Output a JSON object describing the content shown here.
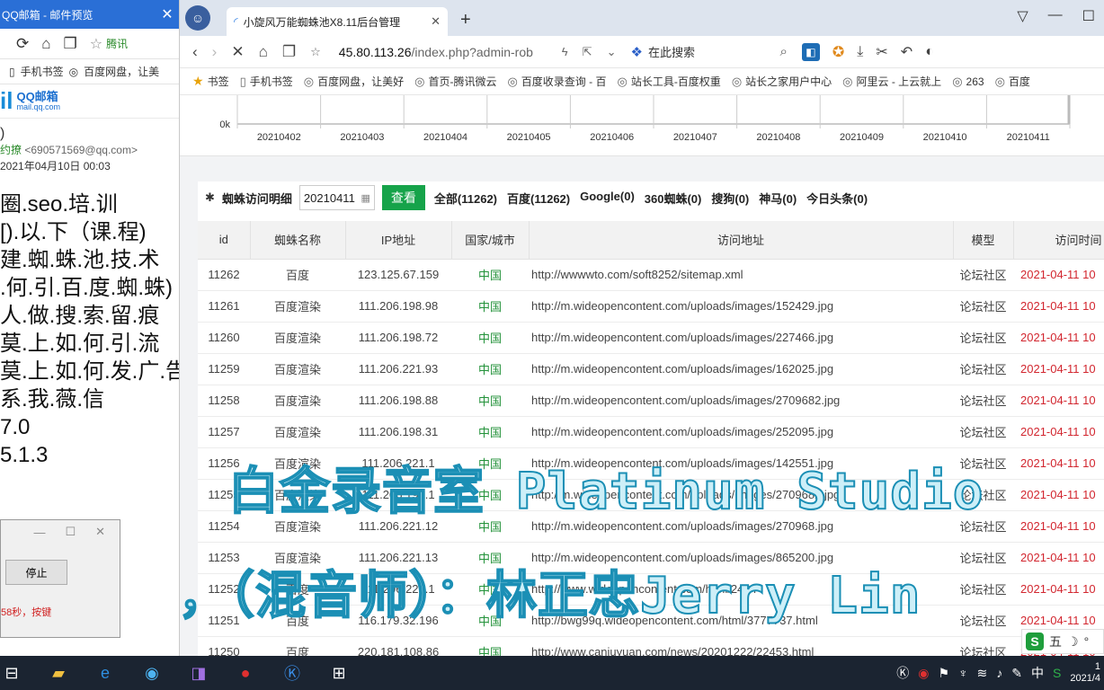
{
  "left_window": {
    "title": "QQ邮箱 - 邮件预览",
    "nav_extra": "腾讯",
    "bookmarks": [
      "手机书签",
      "百度网盘，让美"
    ],
    "logo_title": "QQ邮箱",
    "logo_sub": "mail.qq.com",
    "subject_frag": ")",
    "from_name": "约撩",
    "from_email": "<690571569@qq.com>",
    "date": "2021年04月10日 00:03",
    "body_lines": [
      "圈.seo.培.训",
      "[).以.下（课.程)",
      "建.蜘.蛛.池.技.术",
      ".何.引.百.度.蜘.蛛)",
      "人.做.搜.索.留.痕",
      "莫.上.如.何.引.流",
      "莫.上.如.何.发.广.告",
      "系.我.薇.信",
      "7.0",
      "5.1.3"
    ],
    "dialog": {
      "button": "停止",
      "status": "58秒，按键"
    }
  },
  "browser": {
    "tab_title": "小旋风万能蜘蛛池X8.11后台管理",
    "url_host": "45.80.113.26",
    "url_path": "/index.php?admin-rob",
    "search_placeholder": "在此搜索",
    "bookmarks_label": "书签",
    "bookmarks": [
      "手机书签",
      "百度网盘，让美好",
      "首页-腾讯微云",
      "百度收录查询 - 百",
      "站长工具-百度权重",
      "站长之家用户中心",
      "阿里云 - 上云就上",
      "263",
      "百度"
    ]
  },
  "chart_data": {
    "type": "line",
    "y_tick": "0k",
    "categories": [
      "20210402",
      "20210403",
      "20210404",
      "20210405",
      "20210406",
      "20210407",
      "20210408",
      "20210409",
      "20210410",
      "20210411"
    ]
  },
  "panel": {
    "title": "蜘蛛访问明细",
    "date_value": "20210411",
    "view_button": "查看",
    "filters": [
      "全部(11262)",
      "百度(11262)",
      "Google(0)",
      "360蜘蛛(0)",
      "搜狗(0)",
      "神马(0)",
      "今日头条(0)"
    ],
    "columns": [
      "id",
      "蜘蛛名称",
      "IP地址",
      "国家/城市",
      "访问地址",
      "模型",
      "访问时间"
    ],
    "rows": [
      {
        "id": "11262",
        "name": "百度",
        "ip": "123.125.67.159",
        "country": "中国",
        "url": "http://wwwwto.com/soft8252/sitemap.xml",
        "model": "论坛社区",
        "time": "2021-04-11 10"
      },
      {
        "id": "11261",
        "name": "百度渲染",
        "ip": "111.206.198.98",
        "country": "中国",
        "url": "http://m.wideopencontent.com/uploads/images/152429.jpg",
        "model": "论坛社区",
        "time": "2021-04-11 10"
      },
      {
        "id": "11260",
        "name": "百度渲染",
        "ip": "111.206.198.72",
        "country": "中国",
        "url": "http://m.wideopencontent.com/uploads/images/227466.jpg",
        "model": "论坛社区",
        "time": "2021-04-11 10"
      },
      {
        "id": "11259",
        "name": "百度渲染",
        "ip": "111.206.221.93",
        "country": "中国",
        "url": "http://m.wideopencontent.com/uploads/images/162025.jpg",
        "model": "论坛社区",
        "time": "2021-04-11 10"
      },
      {
        "id": "11258",
        "name": "百度渲染",
        "ip": "111.206.198.88",
        "country": "中国",
        "url": "http://m.wideopencontent.com/uploads/images/2709682.jpg",
        "model": "论坛社区",
        "time": "2021-04-11 10"
      },
      {
        "id": "11257",
        "name": "百度渲染",
        "ip": "111.206.198.31",
        "country": "中国",
        "url": "http://m.wideopencontent.com/uploads/images/252095.jpg",
        "model": "论坛社区",
        "time": "2021-04-11 10"
      },
      {
        "id": "11256",
        "name": "百度渲染",
        "ip": "111.206.221.1",
        "country": "中国",
        "url": "http://m.wideopencontent.com/uploads/images/142551.jpg",
        "model": "论坛社区",
        "time": "2021-04-11 10"
      },
      {
        "id": "11255",
        "name": "百度渲染",
        "ip": "111.206.198.1",
        "country": "中国",
        "url": "http://m.wideopencontent.com/uploads/images/2709682.jpg",
        "model": "论坛社区",
        "time": "2021-04-11 10"
      },
      {
        "id": "11254",
        "name": "百度渲染",
        "ip": "111.206.221.12",
        "country": "中国",
        "url": "http://m.wideopencontent.com/uploads/images/270968.jpg",
        "model": "论坛社区",
        "time": "2021-04-11 10"
      },
      {
        "id": "11253",
        "name": "百度渲染",
        "ip": "111.206.221.13",
        "country": "中国",
        "url": "http://m.wideopencontent.com/uploads/images/865200.jpg",
        "model": "论坛社区",
        "time": "2021-04-11 10"
      },
      {
        "id": "11252",
        "name": "百度",
        "ip": "111.206.221.1",
        "country": "中国",
        "url": "http://www.wideopencontent.com/html/2464",
        "model": "论坛社区",
        "time": "2021-04-11 10"
      },
      {
        "id": "11251",
        "name": "百度",
        "ip": "116.179.32.196",
        "country": "中国",
        "url": "http://bwg99q.wideopencontent.com/html/3777737.html",
        "model": "论坛社区",
        "time": "2021-04-11 10"
      },
      {
        "id": "11250",
        "name": "百度",
        "ip": "220.181.108.86",
        "country": "中国",
        "url": "http://www.canjuyuan.com/news/20201222/22453.html",
        "model": "论坛社区",
        "time": "2021-04-11 10"
      }
    ]
  },
  "watermark": {
    "line1": "白金录音室 Platinum Studio",
    "line2": "，（混音师）：林正忠Jerry Lin"
  },
  "ime": {
    "label": "五"
  },
  "taskbar": {
    "lang": "中",
    "clock_line1": "1",
    "clock_line2": "2021/4"
  }
}
